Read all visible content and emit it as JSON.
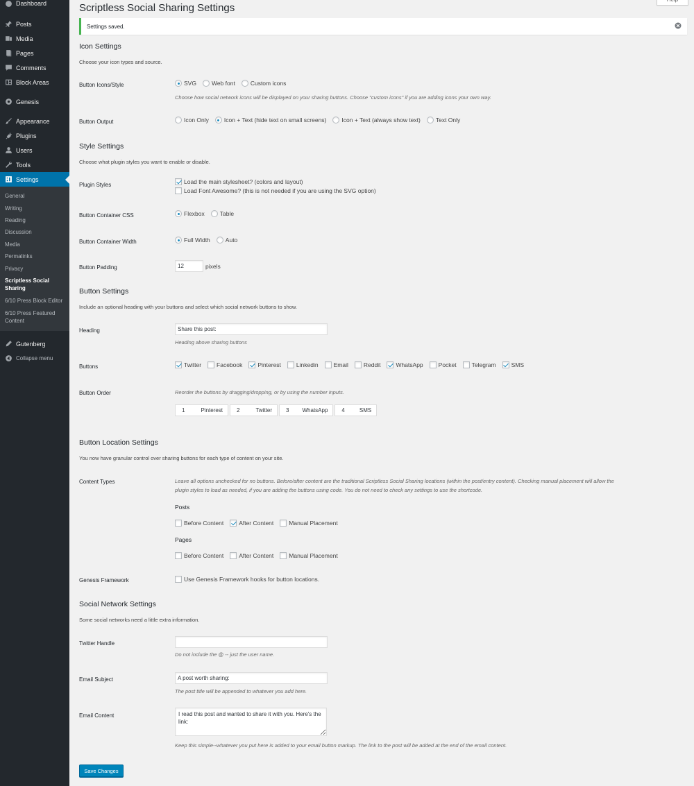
{
  "sidebar": {
    "items": [
      {
        "label": "Dashboard",
        "icon": "dashboard-icon"
      },
      {
        "label": "Posts",
        "icon": "pin-icon"
      },
      {
        "label": "Media",
        "icon": "media-icon"
      },
      {
        "label": "Pages",
        "icon": "page-icon"
      },
      {
        "label": "Comments",
        "icon": "comment-icon"
      },
      {
        "label": "Block Areas",
        "icon": "block-areas-icon"
      },
      {
        "label": "Genesis",
        "icon": "genesis-icon"
      },
      {
        "label": "Appearance",
        "icon": "brush-icon"
      },
      {
        "label": "Plugins",
        "icon": "plugin-icon"
      },
      {
        "label": "Users",
        "icon": "user-icon"
      },
      {
        "label": "Tools",
        "icon": "wrench-icon"
      },
      {
        "label": "Settings",
        "icon": "settings-icon"
      }
    ],
    "submenu": [
      "General",
      "Writing",
      "Reading",
      "Discussion",
      "Media",
      "Permalinks",
      "Privacy",
      "Scriptless Social Sharing",
      "6/10 Press Block Editor",
      "6/10 Press Featured Content"
    ],
    "after": [
      {
        "label": "Gutenberg",
        "icon": "pencil-icon"
      },
      {
        "label": "Collapse menu",
        "icon": "collapse-icon"
      }
    ]
  },
  "page": {
    "title": "Scriptless Social Sharing Settings",
    "help": "Help",
    "notice": "Settings saved."
  },
  "icon_settings": {
    "heading": "Icon Settings",
    "desc": "Choose your icon types and source.",
    "button_icons_label": "Button Icons/Style",
    "button_icons_options": [
      "SVG",
      "Web font",
      "Custom icons"
    ],
    "button_icons_selected": "SVG",
    "button_icons_desc": "Choose how social network icons will be displayed on your sharing buttons. Choose \"custom icons\" if you are adding icons your own way.",
    "button_output_label": "Button Output",
    "button_output_options": [
      "Icon Only",
      "Icon + Text (hide text on small screens)",
      "Icon + Text (always show text)",
      "Text Only"
    ],
    "button_output_selected": "Icon + Text (hide text on small screens)"
  },
  "style_settings": {
    "heading": "Style Settings",
    "desc": "Choose what plugin styles you want to enable or disable.",
    "plugin_styles_label": "Plugin Styles",
    "plugin_styles_main": "Load the main stylesheet? (colors and layout)",
    "plugin_styles_fa": "Load Font Awesome? (this is not needed if you are using the SVG option)",
    "container_css_label": "Button Container CSS",
    "container_css_options": [
      "Flexbox",
      "Table"
    ],
    "container_width_label": "Button Container Width",
    "container_width_options": [
      "Full Width",
      "Auto"
    ],
    "padding_label": "Button Padding",
    "padding_value": "12",
    "padding_unit": "pixels"
  },
  "button_settings": {
    "heading": "Button Settings",
    "desc": "Include an optional heading with your buttons and select which social network buttons to show.",
    "heading_label": "Heading",
    "heading_value": "Share this post:",
    "heading_desc": "Heading above sharing buttons",
    "buttons_label": "Buttons",
    "buttons": [
      {
        "name": "Twitter",
        "checked": true
      },
      {
        "name": "Facebook",
        "checked": false
      },
      {
        "name": "Pinterest",
        "checked": true
      },
      {
        "name": "Linkedin",
        "checked": false
      },
      {
        "name": "Email",
        "checked": false
      },
      {
        "name": "Reddit",
        "checked": false
      },
      {
        "name": "WhatsApp",
        "checked": true
      },
      {
        "name": "Pocket",
        "checked": false
      },
      {
        "name": "Telegram",
        "checked": false
      },
      {
        "name": "SMS",
        "checked": true
      }
    ],
    "order_label": "Button Order",
    "order_desc": "Reorder the buttons by dragging/dropping, or by using the number inputs.",
    "order": [
      {
        "num": "1",
        "name": "Pinterest"
      },
      {
        "num": "2",
        "name": "Twitter"
      },
      {
        "num": "3",
        "name": "WhatsApp"
      },
      {
        "num": "4",
        "name": "SMS"
      }
    ]
  },
  "location_settings": {
    "heading": "Button Location Settings",
    "desc": "You now have granular control over sharing buttons for each type of content on your site.",
    "content_types_label": "Content Types",
    "content_types_desc_1": "Leave all options unchecked for no buttons. Before/after content are the traditional Scriptless Social Sharing locations (within the post/entry content). Checking manual placement will allow the",
    "content_types_desc_2": "plugin styles to load as needed, if you are adding the buttons using code. You do not need to check any settings to use the shortcode.",
    "posts_heading": "Posts",
    "pages_heading": "Pages",
    "location_options": [
      "Before Content",
      "After Content",
      "Manual Placement"
    ],
    "genesis_label": "Genesis Framework",
    "genesis_option": "Use Genesis Framework hooks for button locations."
  },
  "network_settings": {
    "heading": "Social Network Settings",
    "desc": "Some social networks need a little extra information.",
    "twitter_label": "Twitter Handle",
    "twitter_value": "",
    "twitter_desc": "Do not include the @ -- just the user name.",
    "email_subject_label": "Email Subject",
    "email_subject_value": "A post worth sharing:",
    "email_subject_desc": "The post title will be appended to whatever you add here.",
    "email_content_label": "Email Content",
    "email_content_value": "I read this post and wanted to share it with you. Here's the link:",
    "email_content_desc": "Keep this simple--whatever you put here is added to your email button markup. The link to the post will be added at the end of the email content."
  },
  "save_label": "Save Changes",
  "colors": {
    "accent": "#0073aa",
    "sidebar": "#23282d",
    "notice": "#46b450",
    "button": "#0085ba"
  }
}
